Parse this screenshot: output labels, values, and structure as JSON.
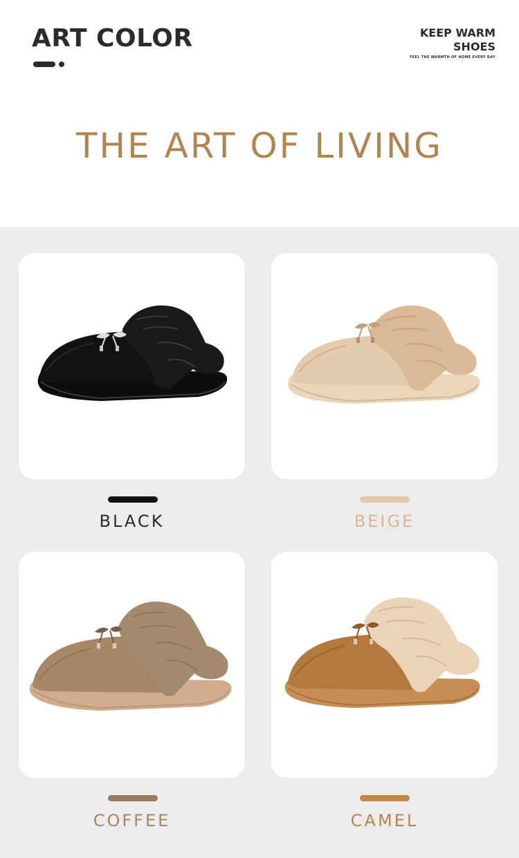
{
  "header": {
    "brand": "ART COLOR",
    "tagline_main_line1": "KEEP WARM",
    "tagline_main_line2": "SHOES",
    "tagline_sub": "FEEL THE WARMTH  OF HOME EVERY DAY"
  },
  "headline": "THE ART OF LIVING",
  "colors": {
    "headline": "#b4844f",
    "page_background": "#ececec"
  },
  "products": [
    {
      "name": "BLACK",
      "swatch_color": "#111111",
      "label_color": "#2b2b2b",
      "image_icon": "black-fur-slipper-icon"
    },
    {
      "name": "BEIGE",
      "swatch_color": "#e2c7a9",
      "label_color": "#d7b896",
      "image_icon": "beige-fur-slipper-icon"
    },
    {
      "name": "COFFEE",
      "swatch_color": "#9b7a62",
      "label_color": "#a88567",
      "image_icon": "coffee-fur-slipper-icon"
    },
    {
      "name": "CAMEL",
      "swatch_color": "#c58843",
      "label_color": "#b8824d",
      "image_icon": "camel-fur-slipper-icon"
    }
  ]
}
